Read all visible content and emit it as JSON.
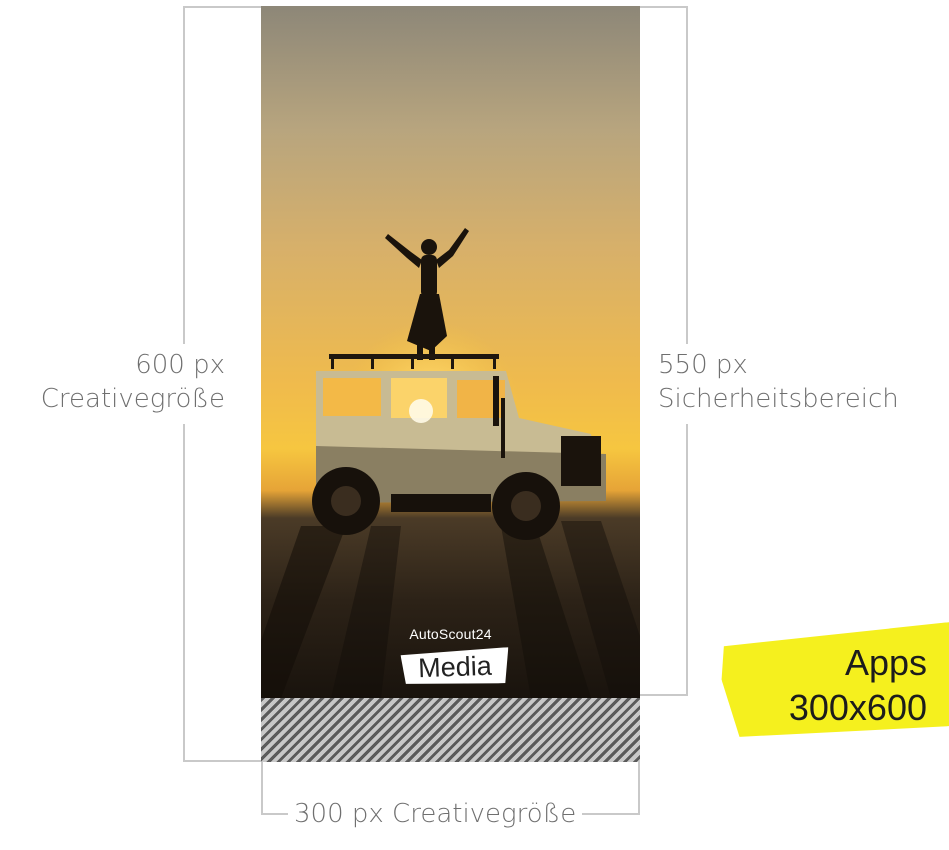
{
  "labels": {
    "left_size": "600 px",
    "left_desc": "Creativegröße",
    "right_size": "550 px",
    "right_desc": "Sicherheitsbereich",
    "bottom": "300 px Creativegröße"
  },
  "logo": {
    "top_text": "AutoScout24",
    "media_text": "Media"
  },
  "badge": {
    "line1": "Apps",
    "line2": "300x600"
  },
  "colors": {
    "accent_yellow": "#f5f01e",
    "guide_line": "#c9c9c9",
    "label_gray": "#6f6f6f"
  }
}
